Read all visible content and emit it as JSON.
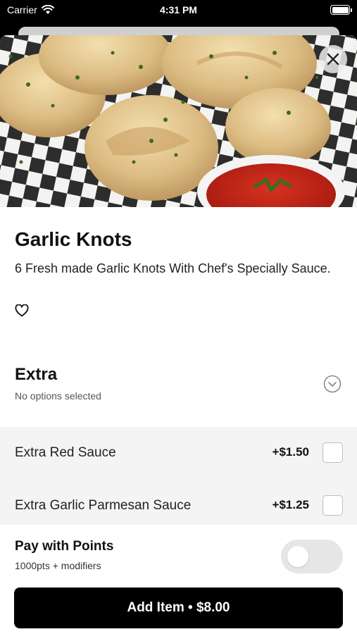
{
  "status_bar": {
    "carrier": "Carrier",
    "time": "4:31 PM"
  },
  "item": {
    "title": "Garlic Knots",
    "description": "6 Fresh made Garlic Knots With Chef's Specially Sauce.",
    "image_icon": "garlic-knots-photo",
    "favorited": false
  },
  "extra_section": {
    "title": "Extra",
    "subtitle": "No options selected",
    "options": [
      {
        "label": "Extra Red Sauce",
        "price": "+$1.50",
        "checked": false
      },
      {
        "label": "Extra Garlic Parmesan Sauce",
        "price": "+$1.25",
        "checked": false
      }
    ]
  },
  "points": {
    "title": "Pay with Points",
    "subtitle": "1000pts + modifiers",
    "enabled": false
  },
  "add_button": {
    "label": "Add Item • $8.00"
  }
}
